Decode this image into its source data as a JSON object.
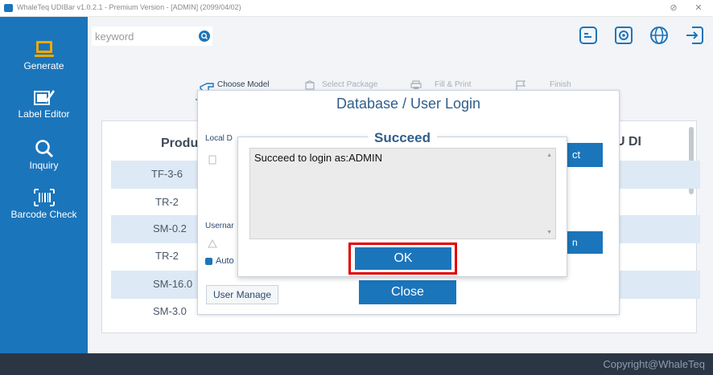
{
  "window": {
    "title": "WhaleTeq UDIBar v1.0.2.1 - Premium Version - [ADMIN] (2099/04/02)",
    "minimize_glyph": "⊘",
    "close_glyph": "✕"
  },
  "sidebar": {
    "items": [
      {
        "label": "Generate",
        "icon": "laptop-icon"
      },
      {
        "label": "Label Editor",
        "icon": "label-edit-icon"
      },
      {
        "label": "Inquiry",
        "icon": "search-icon"
      },
      {
        "label": "Barcode Check",
        "icon": "barcode-icon"
      }
    ]
  },
  "search": {
    "placeholder": "keyword"
  },
  "toolbar": {
    "icons": [
      "template-icon",
      "settings-icon",
      "globe-icon",
      "logout-icon"
    ]
  },
  "wizard": {
    "steps": [
      {
        "label": "Choose Model",
        "active": true
      },
      {
        "label": "Select Package",
        "active": false
      },
      {
        "label": "Fill & Print",
        "active": false
      },
      {
        "label": "Finish",
        "active": false
      }
    ]
  },
  "table": {
    "headers": [
      "Produ",
      "U DI"
    ],
    "rows": [
      "TF-3-6",
      "TR-2",
      "SM-0.2",
      "TR-2",
      "SM-16.0",
      "SM-3.0"
    ]
  },
  "login_dialog": {
    "title": "Database / User Login",
    "local_label": "Local D",
    "username_label": "Usernar",
    "auto_label": "Auto",
    "select_label": "ct",
    "login_label": "n",
    "user_manage_label": "User Manage",
    "close_label": "Close"
  },
  "succeed_dialog": {
    "title": "Succeed",
    "message": "Succeed to login as:ADMIN",
    "ok_label": "OK"
  },
  "footer": {
    "copyright": "Copyright@WhaleTeq"
  },
  "colors": {
    "accent": "#1b75bb",
    "highlight": "#e00000",
    "footer": "#2b3645"
  }
}
